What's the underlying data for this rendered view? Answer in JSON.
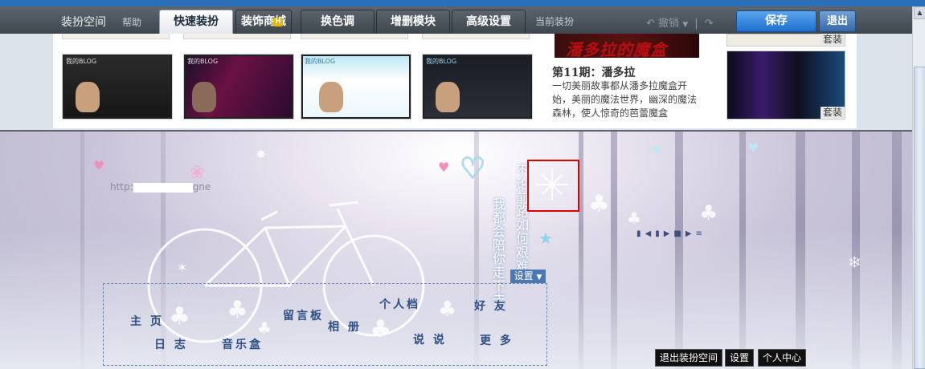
{
  "toolbar": {
    "title": "装扮空间",
    "help": "帮助",
    "tabs": [
      {
        "label": "快速装扮",
        "active": true
      },
      {
        "label": "装饰商城",
        "badge": "H"
      },
      {
        "label": "换色调"
      },
      {
        "label": "增删模块"
      },
      {
        "label": "高级设置"
      }
    ],
    "current_suit": "当前装扮",
    "undo": "撤销",
    "save": "保存",
    "exit": "退出"
  },
  "templates": {
    "thumbnails": [
      {
        "title": "我的BLOG"
      },
      {
        "title": "我的BLOG"
      },
      {
        "title": "我的BLOG"
      },
      {
        "title": "我的BLOG"
      }
    ],
    "feature": {
      "banner_text": "潘多拉的魔盒",
      "title": "第11期：潘多拉",
      "desc": "一切美丽故事都从潘多拉魔盒开始，美丽的魔法世界，幽深的魔法森林，使人惊奇的芭蕾魔盒"
    },
    "suit_label_1": "套装",
    "suit_label_2": "套装"
  },
  "blog": {
    "url_prefix": "http:",
    "url_suffix": "gne",
    "poem_col1": "我都会陪你走下去",
    "poem_col2": "不论前路如何艰难",
    "setting": "设置",
    "nav": {
      "home": "主 页",
      "diary": "日 志",
      "music": "音乐盒",
      "guestbook": "留言板",
      "album": "相 册",
      "profile": "个人档",
      "talk": "说 说",
      "friends": "好 友",
      "more": "更 多"
    },
    "bottom": {
      "exit_decorate": "退出装扮空间",
      "settings": "设置",
      "personal_center": "个人中心"
    }
  },
  "colors": {
    "accent_blue": "#1e6fcf",
    "highlight_red": "#e00000",
    "nav_text": "#2e4e86"
  }
}
